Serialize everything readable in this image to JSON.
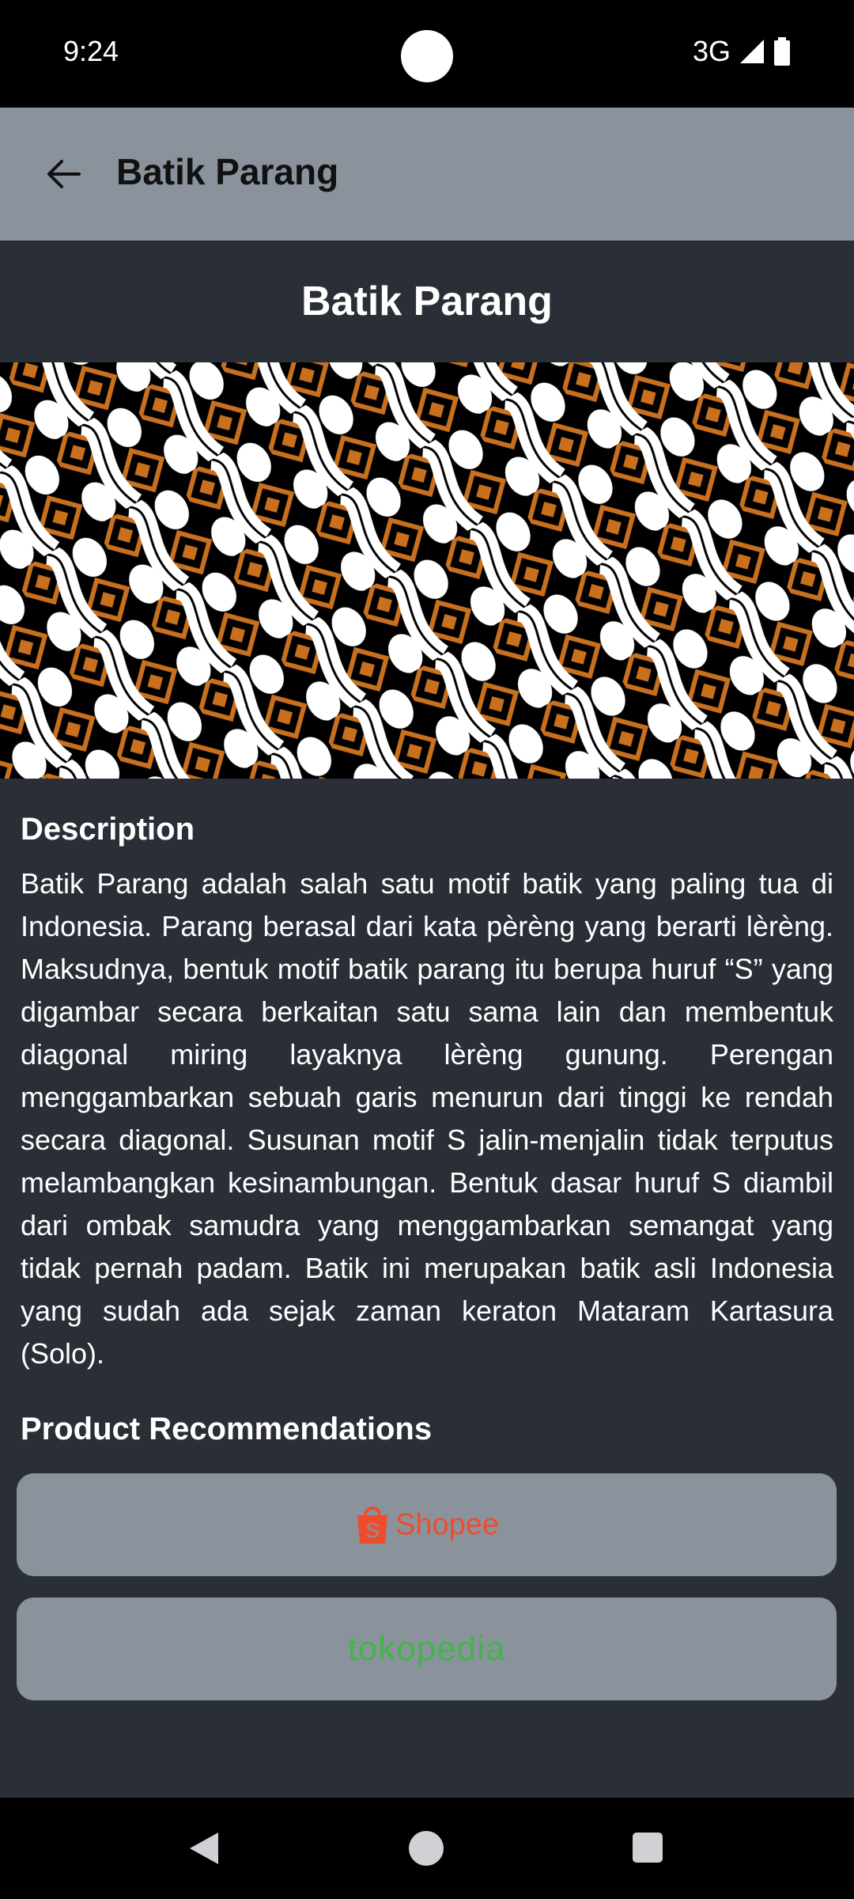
{
  "status_bar": {
    "time": "9:24",
    "network": "3G"
  },
  "app_bar": {
    "title": "Batik Parang"
  },
  "header": {
    "title": "Batik Parang"
  },
  "description": {
    "heading": "Description",
    "text": "Batik Parang adalah salah satu motif batik yang paling tua di Indonesia. Parang berasal dari kata pèrèng yang berarti lèrèng. Maksudnya, bentuk motif batik parang itu berupa huruf “S” yang digambar secara berkaitan satu sama lain dan membentuk diagonal miring layaknya lèrèng gunung. Perengan menggambarkan sebuah garis menurun dari tinggi ke rendah secara diagonal. Susunan motif S jalin-menjalin tidak terputus melambangkan kesinambungan. Bentuk dasar huruf S diambil dari ombak samudra yang menggambarkan semangat yang tidak pernah padam. Batik ini merupakan batik asli Indonesia yang sudah ada sejak zaman keraton Mataram Kartasura (Solo)."
  },
  "recommendations": {
    "heading": "Product Recommendations",
    "shopee_label": "Shopee",
    "tokopedia_label": "tokopedia"
  },
  "icons": {
    "back": "arrow-left-icon",
    "signal": "signal-icon",
    "battery": "battery-icon",
    "shopee": "shopping-bag-icon"
  },
  "colors": {
    "app_bar": "#8a939b",
    "background": "#2a2f37",
    "shopee": "#ee4d2d",
    "tokopedia": "#42b549",
    "batik_brown": "#c8701e"
  }
}
